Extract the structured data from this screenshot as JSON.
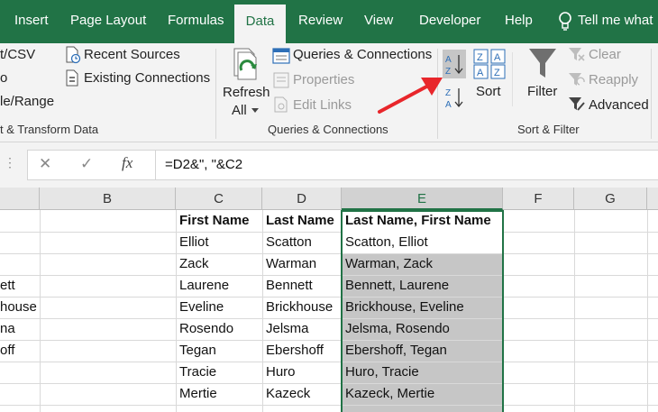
{
  "tabs": [
    {
      "label": "Insert",
      "active": false
    },
    {
      "label": "Page Layout",
      "active": false
    },
    {
      "label": "Formulas",
      "active": false
    },
    {
      "label": "Data",
      "active": true
    },
    {
      "label": "Review",
      "active": false
    },
    {
      "label": "View",
      "active": false
    },
    {
      "label": "Developer",
      "active": false
    },
    {
      "label": "Help",
      "active": false
    }
  ],
  "tell_me": "Tell me what",
  "ribbon": {
    "get_data": {
      "from_csv": "t/CSV",
      "from_web": "o",
      "from_table": "le/Range",
      "group_label": "t & Transform Data"
    },
    "recent_sources": "Recent Sources",
    "existing_connections": "Existing Connections",
    "refresh_all": "Refresh",
    "refresh_all_2": "All",
    "queries_connections": "Queries & Connections",
    "properties": "Properties",
    "edit_links": "Edit Links",
    "queries_group_label": "Queries & Connections",
    "sort": "Sort",
    "filter": "Filter",
    "clear": "Clear",
    "reapply": "Reapply",
    "advanced": "Advanced",
    "sort_filter_group_label": "Sort & Filter"
  },
  "formula_bar": {
    "cancel": "✕",
    "enter": "✓",
    "fx": "fx",
    "formula": "=D2&\", \"&C2"
  },
  "columns": [
    "B",
    "C",
    "D",
    "E",
    "F",
    "G"
  ],
  "headers": {
    "first": "First Name",
    "last": "Last Name",
    "combined": "Last Name, First Name"
  },
  "a_column_fragments": [
    "",
    "",
    "",
    "ett",
    "house",
    "na",
    "off",
    "",
    "",
    ""
  ],
  "rows": [
    {
      "first": "Elliot",
      "last": "Scatton",
      "combined": "Scatton, Elliot"
    },
    {
      "first": "Zack",
      "last": "Warman",
      "combined": "Warman, Zack"
    },
    {
      "first": "Laurene",
      "last": "Bennett",
      "combined": "Bennett, Laurene"
    },
    {
      "first": "Eveline",
      "last": "Brickhouse",
      "combined": "Brickhouse, Eveline"
    },
    {
      "first": "Rosendo",
      "last": "Jelsma",
      "combined": "Jelsma, Rosendo"
    },
    {
      "first": "Tegan",
      "last": "Ebershoff",
      "combined": "Ebershoff, Tegan"
    },
    {
      "first": "Tracie",
      "last": "Huro",
      "combined": "Huro, Tracie"
    },
    {
      "first": "Mertie",
      "last": "Kazeck",
      "combined": "Kazeck, Mertie"
    }
  ],
  "colors": {
    "excel_green": "#217346",
    "annotation_red": "#e8262b",
    "selection_fill": "#c6c6c6"
  }
}
